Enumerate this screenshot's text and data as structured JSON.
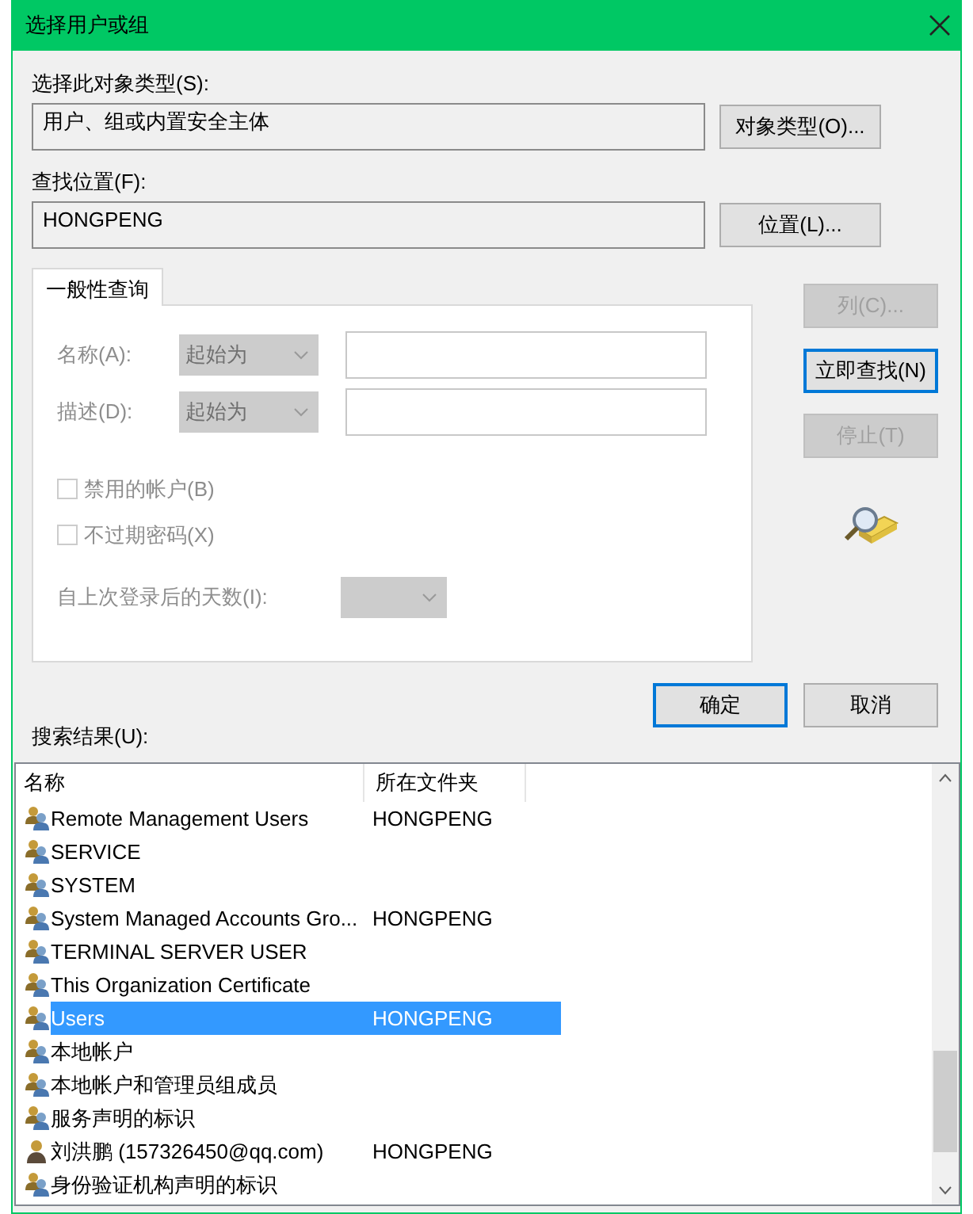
{
  "window": {
    "title": "选择用户或组"
  },
  "object_type": {
    "label": "选择此对象类型(S):",
    "value": "用户、组或内置安全主体",
    "button": "对象类型(O)..."
  },
  "location": {
    "label": "查找位置(F):",
    "value": "HONGPENG",
    "button": "位置(L)..."
  },
  "tabs": [
    {
      "label": "一般性查询",
      "selected": true
    }
  ],
  "query": {
    "fields": [
      {
        "label": "名称(A):",
        "operator": "起始为",
        "disabled": true
      },
      {
        "label": "描述(D):",
        "operator": "起始为",
        "disabled": true
      }
    ],
    "checkboxes": [
      {
        "label": "禁用的帐户(B)",
        "checked": false,
        "disabled": true
      },
      {
        "label": "不过期密码(X)",
        "checked": false,
        "disabled": true
      }
    ],
    "days": {
      "label": "自上次登录后的天数(I):",
      "disabled": true
    }
  },
  "side_buttons": [
    {
      "label": "列(C)...",
      "disabled": true,
      "default": false
    },
    {
      "label": "立即查找(N)",
      "disabled": false,
      "default": true
    },
    {
      "label": "停止(T)",
      "disabled": true,
      "default": false
    }
  ],
  "dialog_buttons": [
    {
      "label": "确定",
      "default": true
    },
    {
      "label": "取消",
      "default": false
    }
  ],
  "results": {
    "label": "搜索结果(U):",
    "columns": [
      "名称",
      "所在文件夹"
    ],
    "rows": [
      {
        "name": "Remote Management Users",
        "folder": "HONGPENG",
        "kind": "group",
        "selected": false
      },
      {
        "name": "SERVICE",
        "kind": "group",
        "selected": false
      },
      {
        "name": "SYSTEM",
        "kind": "group",
        "selected": false
      },
      {
        "name": "System Managed Accounts Gro...",
        "folder": "HONGPENG",
        "kind": "group",
        "selected": false
      },
      {
        "name": "TERMINAL SERVER USER",
        "kind": "group",
        "selected": false
      },
      {
        "name": "This Organization Certificate",
        "kind": "group",
        "selected": false
      },
      {
        "name": "Users",
        "folder": "HONGPENG",
        "kind": "group",
        "selected": true
      },
      {
        "name": "本地帐户",
        "kind": "group",
        "selected": false
      },
      {
        "name": "本地帐户和管理员组成员",
        "kind": "group",
        "selected": false
      },
      {
        "name": "服务声明的标识",
        "kind": "group",
        "selected": false
      },
      {
        "name": "刘洪鹏 (157326450@qq.com)",
        "folder": "HONGPENG",
        "kind": "user",
        "selected": false
      },
      {
        "name": "身份验证机构声明的标识",
        "kind": "group",
        "selected": false
      }
    ]
  }
}
